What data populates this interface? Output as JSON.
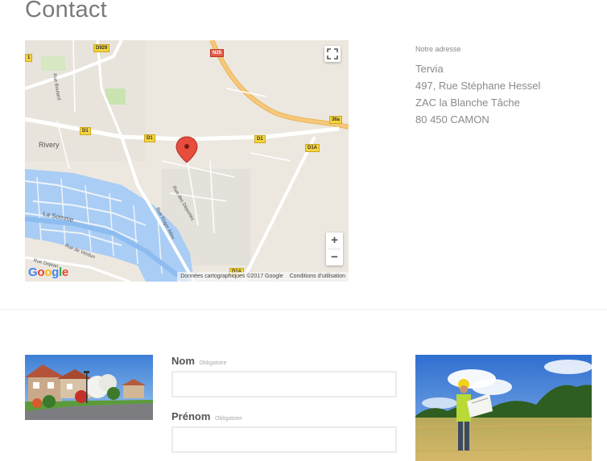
{
  "page": {
    "title": "Contact"
  },
  "map": {
    "place_label": "Rivery",
    "river_label": "La Somme",
    "street_labels": [
      "Rue Boutard",
      "Rue des Déportés",
      "Rue Roger Allou",
      "Rue de Verdun",
      "Rue Dejean"
    ],
    "road_shields": [
      "D929",
      "N25",
      "D1",
      "D1",
      "D1",
      "D1A",
      "D1A",
      "36a",
      "1"
    ],
    "attribution": "Données cartographiques ©2017 Google",
    "terms": "Conditions d'utilisation",
    "logo": "Google",
    "zoom_in": "+",
    "zoom_out": "−",
    "colors": {
      "background": "#ece8e0",
      "water": "#a3ccff",
      "park": "#c9e4b0",
      "highway": "#f7c87a",
      "road": "#ffffff",
      "marker": "#e74c3c"
    }
  },
  "address": {
    "heading": "Notre adresse",
    "company": "Tervia",
    "street": "497, Rue Stéphane Hessel",
    "zone": "ZAC la Blanche Tâche",
    "city": "80 450 CAMON"
  },
  "form": {
    "fields": [
      {
        "label": "Nom",
        "required": "Obligatoire",
        "value": "",
        "placeholder": ""
      },
      {
        "label": "Prénom",
        "required": "Obligatoire",
        "value": "",
        "placeholder": ""
      }
    ]
  }
}
